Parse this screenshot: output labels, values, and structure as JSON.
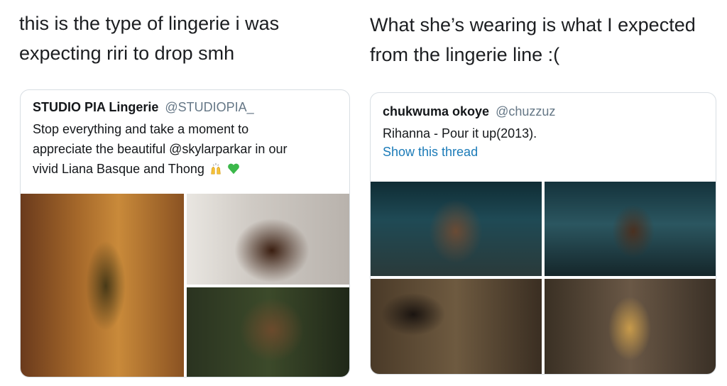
{
  "left": {
    "caption_lines": [
      "this is the type of lingerie i was",
      "expecting riri to drop smh"
    ],
    "tweet": {
      "display_name": "STUDIO PIA Lingerie",
      "handle": "@STUDIOPIA_",
      "text_lines": [
        "Stop everything and take a moment to",
        "appreciate the beautiful @skylarparkar in our",
        "vivid Liana Basque and Thong"
      ],
      "emojis": [
        "raised-hands-icon",
        "green-heart-icon"
      ],
      "photos": [
        "lingerie-photo-front",
        "lingerie-photo-back",
        "lingerie-photo-detail"
      ]
    }
  },
  "right": {
    "caption_lines": [
      "What she’s wearing is what I expected",
      "from the lingerie line :("
    ],
    "tweet": {
      "display_name": "chukwuma okoye",
      "handle": "@chuzzuz",
      "text_lines": [
        "Rihanna - Pour it up(2013)."
      ],
      "show_thread": "Show this thread",
      "photos": [
        "throne-photo-1",
        "throne-photo-2",
        "floor-photo",
        "chain-belt-photo"
      ]
    }
  },
  "colors": {
    "link": "#1b7bb8",
    "handle": "#657786",
    "border": "#d8dee3"
  }
}
